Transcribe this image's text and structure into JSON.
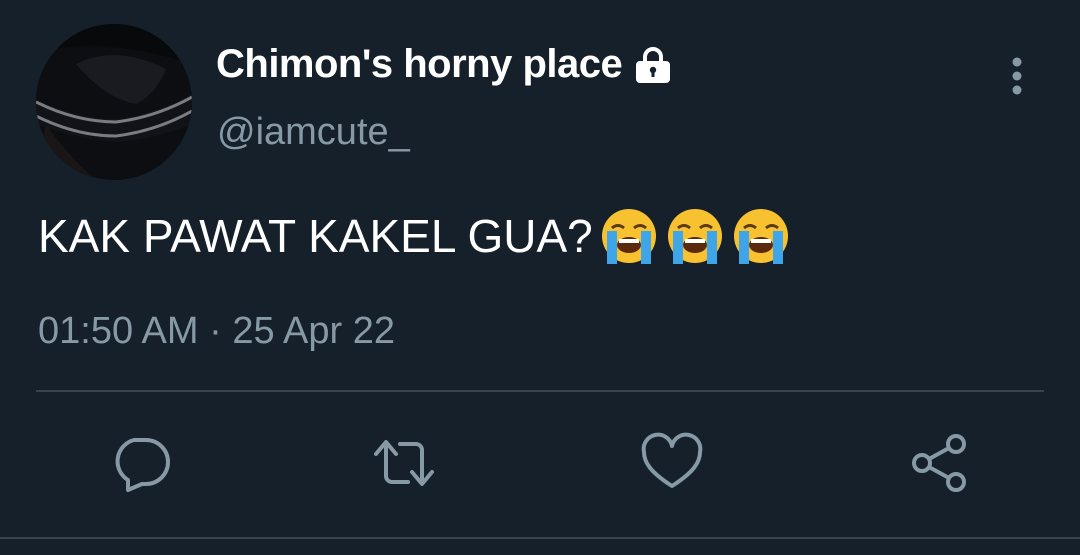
{
  "tweet": {
    "display_name": "Chimon's horny place",
    "handle": "@iamcute_",
    "text": "KAK PAWAT KAKEL GUA?",
    "emojis": [
      "loudly-crying-face",
      "loudly-crying-face",
      "loudly-crying-face"
    ],
    "timestamp": "01:50 AM · 25 Apr 22",
    "protected": true
  },
  "icons": {
    "lock": "lock-icon",
    "more": "more-vertical-icon",
    "reply": "reply-icon",
    "retweet": "retweet-icon",
    "like": "heart-icon",
    "share": "share-icon"
  },
  "colors": {
    "background": "#15202b",
    "text_primary": "#ffffff",
    "text_secondary": "#8899a6",
    "divider": "#38444d",
    "icon": "#8899a6"
  }
}
